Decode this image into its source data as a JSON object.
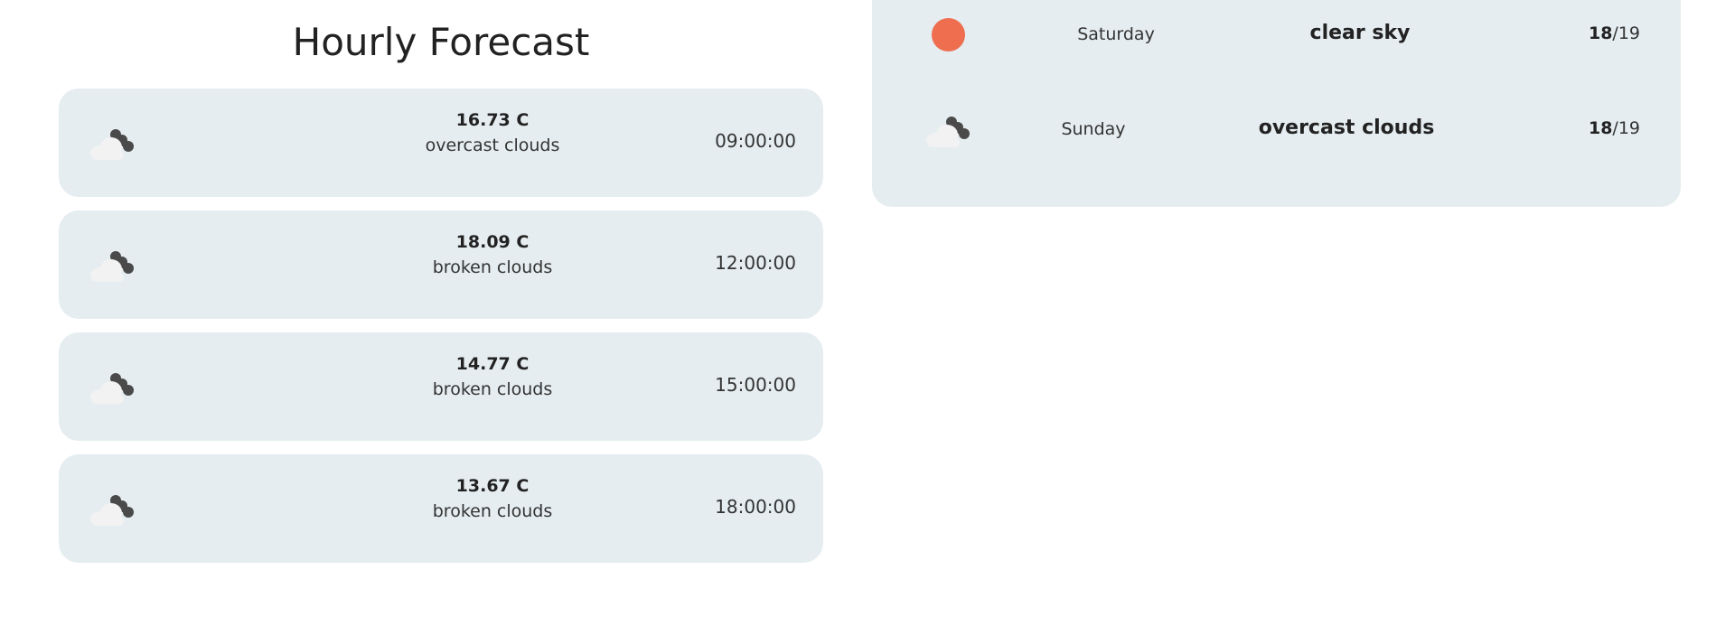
{
  "hourly": {
    "title": "Hourly Forecast",
    "items": [
      {
        "temp": "16.73 C",
        "description": "overcast clouds",
        "time": "09:00:00",
        "icon": "broken-clouds-icon"
      },
      {
        "temp": "18.09 C",
        "description": "broken clouds",
        "time": "12:00:00",
        "icon": "broken-clouds-icon"
      },
      {
        "temp": "14.77 C",
        "description": "broken clouds",
        "time": "15:00:00",
        "icon": "broken-clouds-icon"
      },
      {
        "temp": "13.67 C",
        "description": "broken clouds",
        "time": "18:00:00",
        "icon": "broken-clouds-icon"
      }
    ]
  },
  "daily": {
    "items": [
      {
        "day": "Saturday",
        "condition": "clear sky",
        "min": "18",
        "max": "/19",
        "icon": "sun-icon"
      },
      {
        "day": "Sunday",
        "condition": "overcast clouds",
        "min": "18",
        "max": "/19",
        "icon": "broken-clouds-icon"
      }
    ]
  },
  "colors": {
    "card_background": "#e5edf0",
    "sun": "#ee6e4f",
    "cloud_dark": "#4a4a4a",
    "cloud_light": "#f2f2f2"
  }
}
